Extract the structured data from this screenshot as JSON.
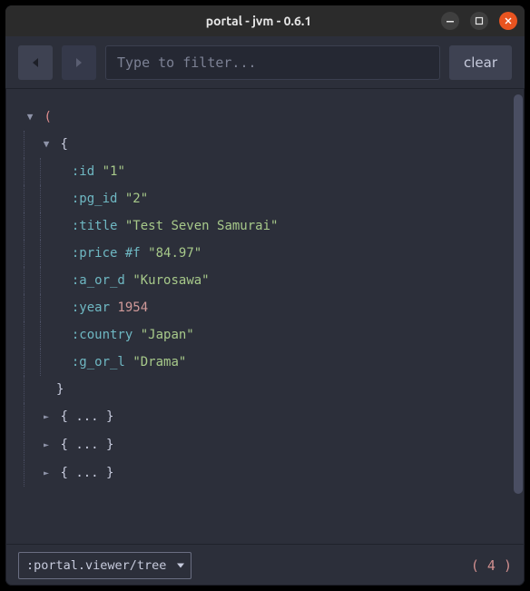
{
  "window": {
    "title": "portal - jvm - 0.6.1"
  },
  "toolbar": {
    "filter_placeholder": "Type to filter...",
    "clear_label": "clear"
  },
  "tree": {
    "open_paren": "(",
    "open_brace": "{",
    "close_brace": "}",
    "dots": "...",
    "entries": [
      {
        "key": ":id",
        "value": "\"1\"",
        "value_class": "str"
      },
      {
        "key": ":pg_id",
        "value": "\"2\"",
        "value_class": "str"
      },
      {
        "key": ":title",
        "value": "\"Test Seven Samurai\"",
        "value_class": "str"
      },
      {
        "key": ":price",
        "prefix": "#f ",
        "prefix_class": "tag",
        "value": "\"84.97\"",
        "value_class": "str"
      },
      {
        "key": ":a_or_d",
        "value": "\"Kurosawa\"",
        "value_class": "str"
      },
      {
        "key": ":year",
        "value": "1954",
        "value_class": "num"
      },
      {
        "key": ":country",
        "value": "\"Japan\"",
        "value_class": "str"
      },
      {
        "key": ":g_or_l",
        "value": "\"Drama\"",
        "value_class": "str"
      }
    ],
    "collapsed_count": 3
  },
  "footer": {
    "viewer_options": [
      ":portal.viewer/tree"
    ],
    "viewer_selected": ":portal.viewer/tree",
    "count_display": "( 4 )"
  },
  "scrollbar": {
    "thumb_top": 0,
    "thumb_height": 440
  }
}
